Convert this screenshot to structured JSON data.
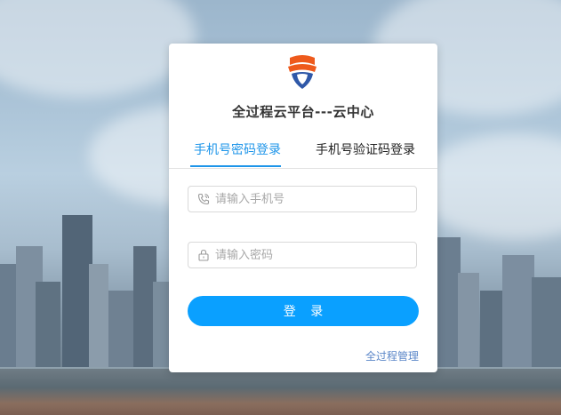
{
  "brand": {
    "logo_icon": "shield-logo-icon",
    "colors": {
      "logo_orange": "#ee5a1c",
      "logo_blue": "#2f58a8"
    }
  },
  "login": {
    "title": "全过程云平台---云中心",
    "tabs": [
      {
        "label": "手机号密码登录",
        "active": true
      },
      {
        "label": "手机号验证码登录",
        "active": false
      }
    ],
    "phone_field": {
      "icon": "phone-icon",
      "placeholder": "请输入手机号",
      "value": ""
    },
    "password_field": {
      "icon": "lock-icon",
      "placeholder": "请输入密码",
      "value": ""
    },
    "submit_label": "登 录",
    "footer_link": "全过程管理"
  },
  "theme": {
    "accent": "#1e95e9",
    "button": "#0aa0ff",
    "link": "#5a86c8"
  }
}
